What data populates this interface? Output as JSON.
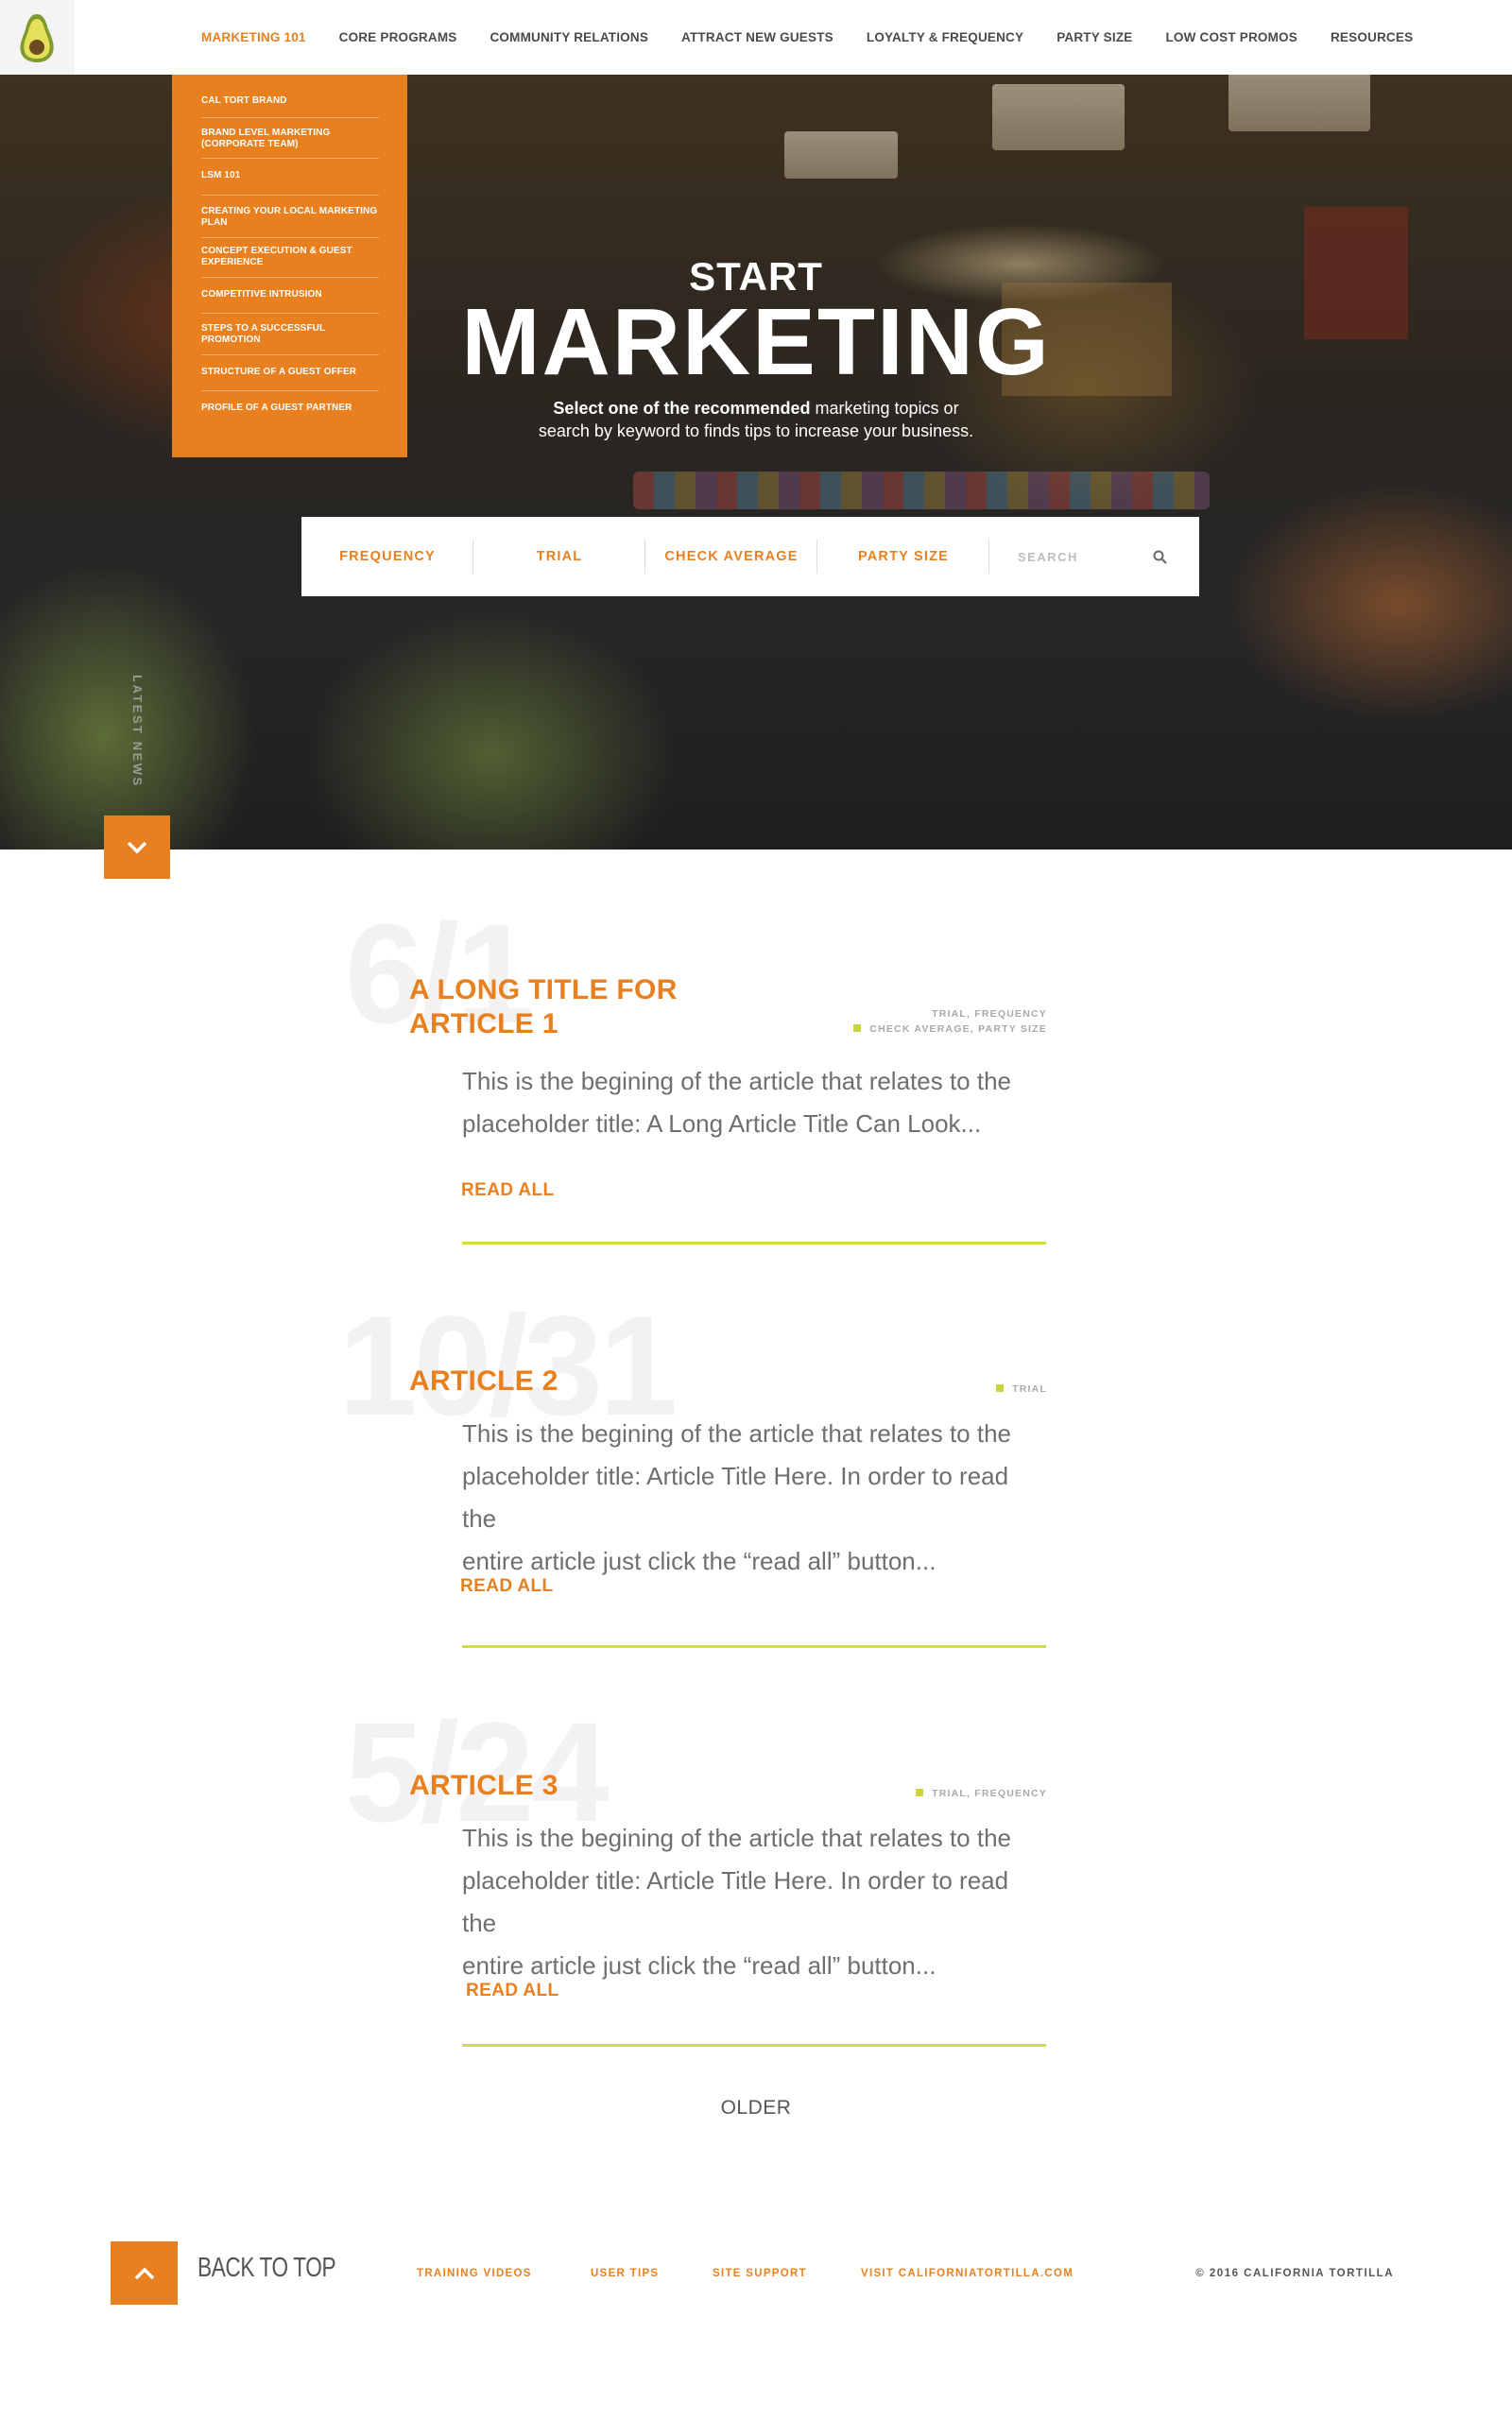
{
  "nav": {
    "logo": "avocado-logo",
    "items": [
      {
        "label": "MARKETING 101",
        "active": true
      },
      {
        "label": "CORE PROGRAMS"
      },
      {
        "label": "COMMUNITY RELATIONS"
      },
      {
        "label": "ATTRACT NEW GUESTS"
      },
      {
        "label": "LOYALTY & FREQUENCY"
      },
      {
        "label": "PARTY SIZE"
      },
      {
        "label": "LOW COST PROMOS"
      },
      {
        "label": "RESOURCES"
      }
    ]
  },
  "dropdown": {
    "items": [
      "CAL TORT BRAND",
      "BRAND LEVEL MARKETING (CORPORATE TEAM)",
      "LSM 101",
      "CREATING YOUR LOCAL MARKETING PLAN",
      "CONCEPT EXECUTION & GUEST EXPERIENCE",
      "COMPETITIVE INTRUSION",
      "STEPS TO A SUCCESSFUL PROMOTION",
      "STRUCTURE OF A GUEST OFFER",
      "PROFILE OF A GUEST PARTNER"
    ]
  },
  "hero": {
    "title_small": "START",
    "title_large": "MARKETING",
    "subtitle_bold": "Select one of the recommended",
    "subtitle_rest": " marketing topics or",
    "subtitle_line2": "search by keyword to finds tips to increase your business.",
    "side_label": "LATEST NEWS"
  },
  "filters": {
    "buttons": [
      "FREQUENCY",
      "TRIAL",
      "CHECK AVERAGE",
      "PARTY SIZE"
    ],
    "search_placeholder": "SEARCH"
  },
  "articles": [
    {
      "date": "6/1",
      "title_line1": "A LONG TITLE FOR",
      "title_line2": "ARTICLE 1",
      "tags_line1": "TRIAL, FREQUENCY",
      "tags_line2": "CHECK AVERAGE, PARTY SIZE",
      "body": [
        "This is the begining of the article that relates to the",
        "placeholder title: A Long Article Title Can Look..."
      ],
      "read": "READ ALL"
    },
    {
      "date": "10/31",
      "title_line1": "ARTICLE 2",
      "tags_line1": "TRIAL",
      "body": [
        "This is the begining of the article that relates to the",
        "placeholder title: Article Title Here. In order to read the",
        "entire article just click the “read all” button..."
      ],
      "read": "READ ALL"
    },
    {
      "date": "5/24",
      "title_line1": "ARTICLE 3",
      "tags_line1": "TRIAL, FREQUENCY",
      "body": [
        "This is the begining of the article that relates to the",
        "placeholder title: Article Title Here. In order to read the",
        "entire article just click the “read all” button..."
      ],
      "read": "READ ALL"
    }
  ],
  "older": "OLDER",
  "footer": {
    "back_to_top": "BACK TO TOP",
    "links": [
      "TRAINING VIDEOS",
      "USER TIPS",
      "SITE SUPPORT",
      "VISIT CALIFORNIATORTILLA.COM"
    ],
    "copyright": "© 2016 CALIFORNIA TORTILLA"
  },
  "colors": {
    "accent": "#e8801f",
    "lime": "#d2da48"
  }
}
